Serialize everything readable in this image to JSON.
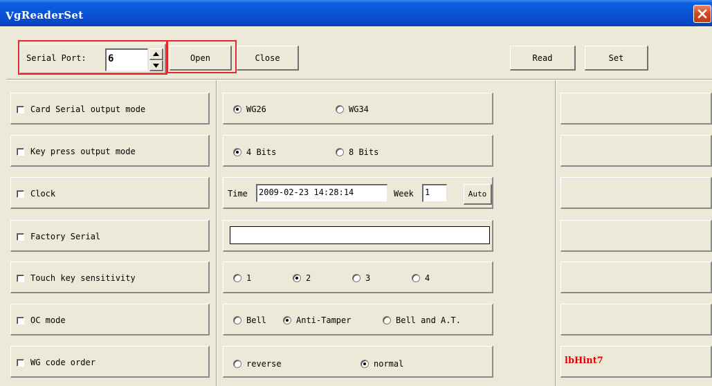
{
  "window": {
    "title_prefix": "V",
    "title_rest": "gReaderSet",
    "close_icon": "close-x-icon"
  },
  "toolbar": {
    "serial_port_label": "Serial Port:",
    "serial_port_value": "6",
    "open_label": "Open",
    "close_label": "Close",
    "read_label": "Read",
    "set_label": "Set"
  },
  "options": [
    {
      "label": "Card Serial output mode",
      "checked": false
    },
    {
      "label": "Key press output mode",
      "checked": false
    },
    {
      "label": "Clock",
      "checked": false
    },
    {
      "label": "Factory Serial",
      "checked": false
    },
    {
      "label": "Touch key sensitivity",
      "checked": false
    },
    {
      "label": "OC mode",
      "checked": false
    },
    {
      "label": "WG code order",
      "checked": false
    }
  ],
  "card_serial": {
    "wg26": "WG26",
    "wg34": "WG34",
    "selected": "WG26"
  },
  "key_press": {
    "bits4": "4 Bits",
    "bits8": "8 Bits",
    "selected": "4 Bits"
  },
  "clock": {
    "time_label": "Time",
    "time_value": "2009-02-23 14:28:14",
    "week_label": "Week",
    "week_value": "1",
    "auto_label": "Auto"
  },
  "factory_serial": {
    "value": ""
  },
  "touch_sensitivity": {
    "o1": "1",
    "o2": "2",
    "o3": "3",
    "o4": "4",
    "selected": "2"
  },
  "oc_mode": {
    "bell": "Bell",
    "anti_tamper": "Anti-Tamper",
    "bell_at": "Bell and A.T.",
    "selected": "Anti-Tamper"
  },
  "wg_order": {
    "reverse": "reverse",
    "normal": "normal",
    "selected": "normal"
  },
  "hint_label": "lbHint7"
}
